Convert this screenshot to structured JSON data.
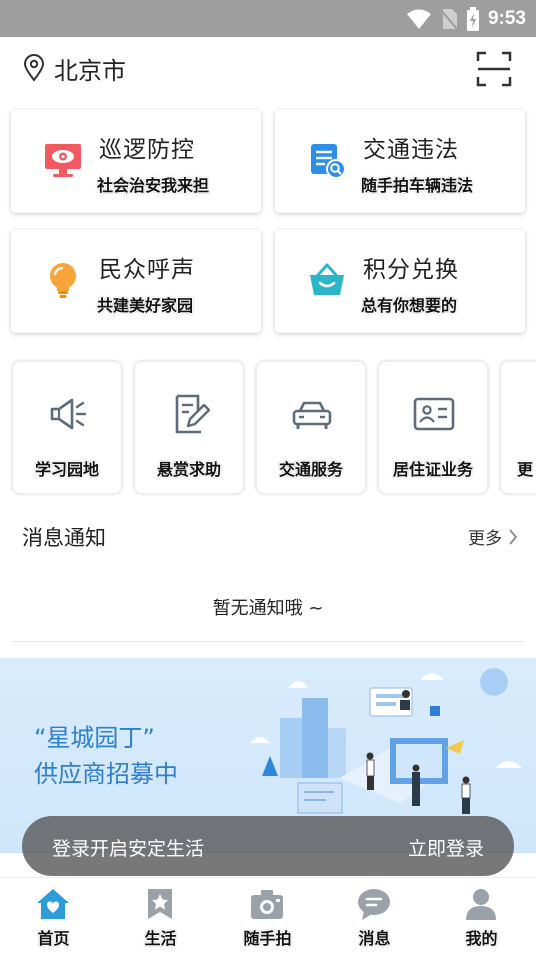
{
  "status_bar": {
    "time": "9:53"
  },
  "header": {
    "city": "北京市"
  },
  "cards": [
    {
      "title": "巡逻防控",
      "subtitle": "社会治安我来担",
      "icon": "monitor-eye-icon"
    },
    {
      "title": "交通违法",
      "subtitle": "随手拍车辆违法",
      "icon": "document-search-icon"
    },
    {
      "title": "民众呼声",
      "subtitle": "共建美好家园",
      "icon": "lightbulb-icon"
    },
    {
      "title": "积分兑换",
      "subtitle": "总有你想要的",
      "icon": "shopping-basket-icon"
    }
  ],
  "services": [
    {
      "label": "学习园地",
      "icon": "megaphone-icon"
    },
    {
      "label": "悬赏求助",
      "icon": "edit-document-icon"
    },
    {
      "label": "交通服务",
      "icon": "car-icon"
    },
    {
      "label": "居住证业务",
      "icon": "id-card-icon"
    },
    {
      "label": "更",
      "icon": "more-service-icon"
    }
  ],
  "notifications": {
    "title": "消息通知",
    "more_label": "更多",
    "empty_text": "暂无通知哦 ~"
  },
  "banner": {
    "line1": "“星城园丁”",
    "line2": "供应商招募中"
  },
  "toast": {
    "text": "登录开启安定生活",
    "button": "立即登录"
  },
  "tabbar": [
    {
      "label": "首页",
      "icon": "home-icon",
      "active": true
    },
    {
      "label": "生活",
      "icon": "star-bookmark-icon",
      "active": false
    },
    {
      "label": "随手拍",
      "icon": "camera-icon",
      "active": false
    },
    {
      "label": "消息",
      "icon": "chat-bubble-icon",
      "active": false
    },
    {
      "label": "我的",
      "icon": "user-icon",
      "active": false
    }
  ],
  "colors": {
    "accent": "#2d9cdb",
    "banner_text": "#2d7fd0",
    "icon_gray": "#5f6b78",
    "tab_inactive": "#9aa1a9"
  }
}
